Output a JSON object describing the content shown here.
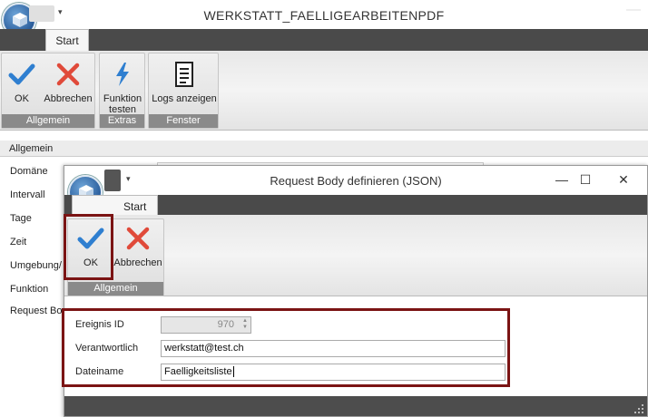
{
  "main_window": {
    "title": "WERKSTATT_FAELLIGEARBEITENPDF",
    "tab_start": "Start",
    "groups": [
      {
        "label": "Allgemein",
        "buttons": [
          {
            "label": "OK",
            "icon": "checkmark-icon"
          },
          {
            "label": "Abbrechen",
            "icon": "cross-icon"
          }
        ]
      },
      {
        "label": "Extras",
        "buttons": [
          {
            "label": "Funktion testen",
            "icon": "lightning-icon"
          }
        ]
      },
      {
        "label": "Fenster",
        "buttons": [
          {
            "label": "Logs anzeigen",
            "icon": "log-document-icon"
          }
        ]
      }
    ],
    "section_header": "Allgemein",
    "properties": [
      "Domäne",
      "Intervall",
      "Tage",
      "Zeit",
      "Umgebung/",
      "Funktion",
      "Request Bo"
    ]
  },
  "dialog": {
    "title": "Request Body definieren (JSON)",
    "tab_start": "Start",
    "group_label": "Allgemein",
    "ok_label": "OK",
    "cancel_label": "Abbrechen",
    "fields": {
      "ereignis_label": "Ereignis ID",
      "ereignis_value": "970",
      "verantwortlich_label": "Verantwortlich",
      "verantwortlich_value": "werkstatt@test.ch",
      "dateiname_label": "Dateiname",
      "dateiname_value": "Faelligkeitsliste"
    }
  },
  "colors": {
    "accent_blue": "#2f7fd0",
    "cancel_red": "#e04a3a",
    "highlight_border": "#7b1414",
    "tabbar": "#4a4a4a"
  }
}
